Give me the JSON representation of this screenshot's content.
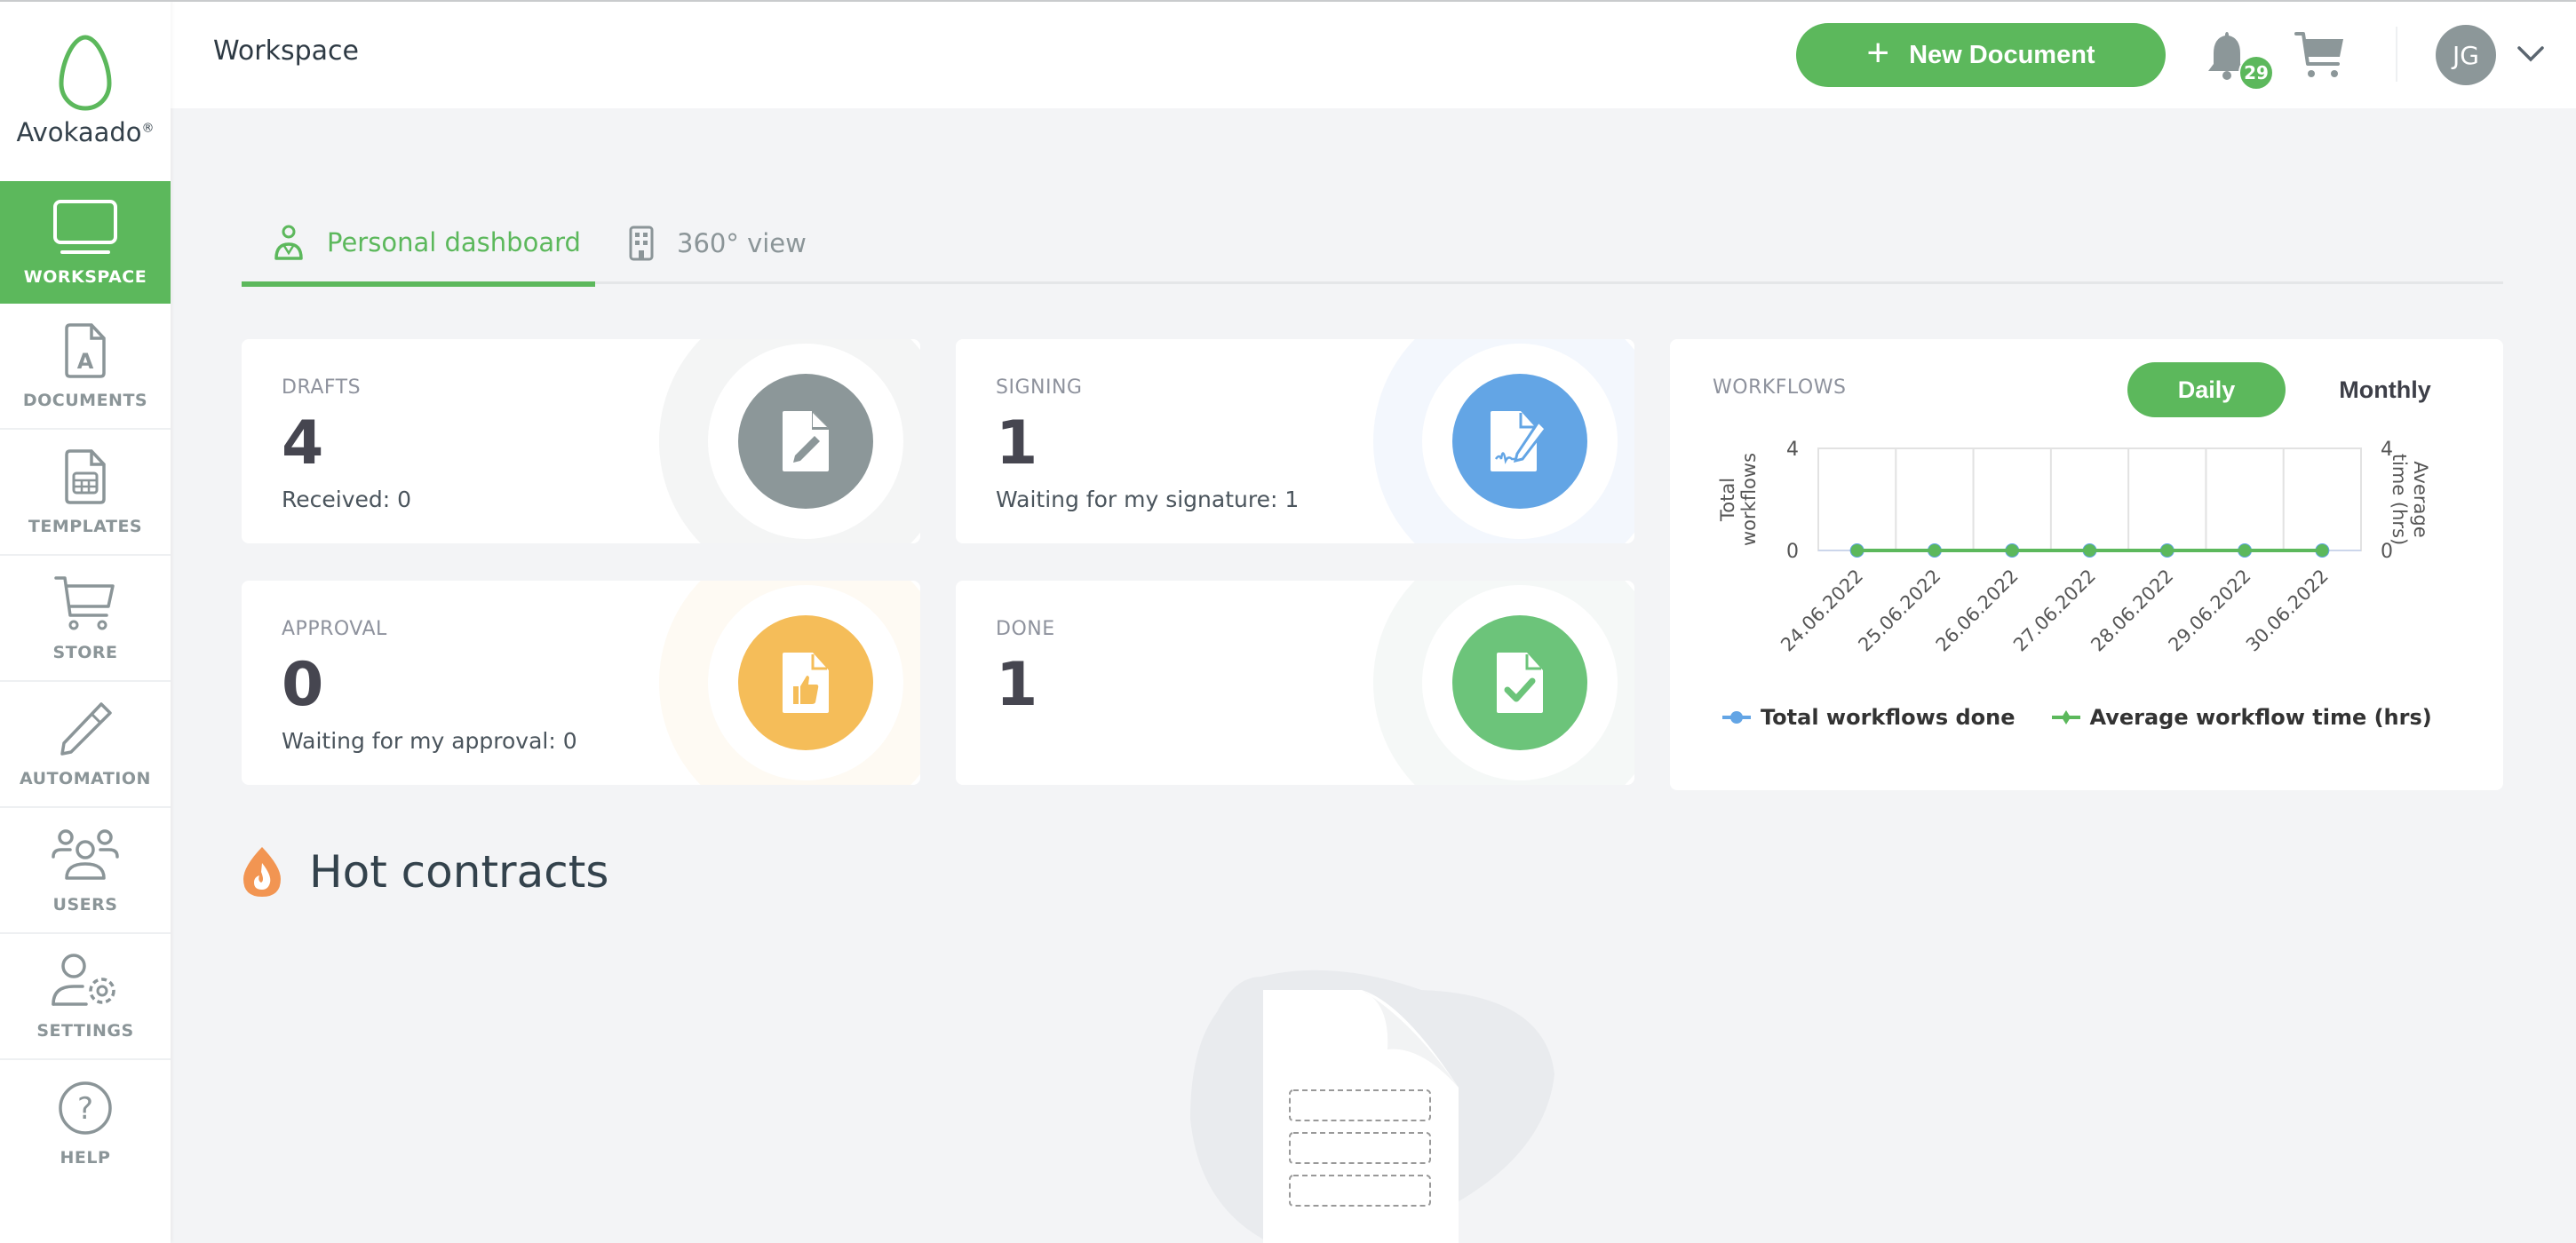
{
  "app": {
    "brand": "Avokaado",
    "brand_mark": "®"
  },
  "sidebar": {
    "items": [
      {
        "label": "WORKSPACE",
        "icon": "monitor-icon",
        "active": true
      },
      {
        "label": "DOCUMENTS",
        "icon": "document-a-icon"
      },
      {
        "label": "TEMPLATES",
        "icon": "template-icon"
      },
      {
        "label": "STORE",
        "icon": "cart-icon"
      },
      {
        "label": "AUTOMATION",
        "icon": "pen-icon"
      },
      {
        "label": "USERS",
        "icon": "users-icon"
      },
      {
        "label": "SETTINGS",
        "icon": "user-gear-icon"
      },
      {
        "label": "HELP",
        "icon": "help-icon"
      }
    ]
  },
  "header": {
    "title": "Workspace",
    "new_document_label": "New Document",
    "notifications_count": "29",
    "user_initials": "JG"
  },
  "tabs": [
    {
      "label": "Personal dashboard",
      "active": true,
      "icon": "person-icon"
    },
    {
      "label": "360° view",
      "active": false,
      "icon": "building-icon"
    }
  ],
  "stats": [
    {
      "title": "DRAFTS",
      "value": "4",
      "sub": "Received: 0",
      "color": "#8c9799",
      "icon": "draft-document-icon"
    },
    {
      "title": "SIGNING",
      "value": "1",
      "sub": "Waiting for my signature: 1",
      "color": "#63a5e5",
      "icon": "signature-document-icon"
    },
    {
      "title": "APPROVAL",
      "value": "0",
      "sub": "Waiting for my approval: 0",
      "color": "#f5bd59",
      "icon": "thumbs-up-document-icon"
    },
    {
      "title": "DONE",
      "value": "1",
      "sub": "",
      "color": "#6cc47a",
      "icon": "check-document-icon"
    }
  ],
  "workflows": {
    "title": "WORKFLOWS",
    "daily_label": "Daily",
    "monthly_label": "Monthly",
    "selected": "Daily"
  },
  "chart_data": {
    "type": "line",
    "title": "WORKFLOWS",
    "categories": [
      "24.06.2022",
      "25.06.2022",
      "26.06.2022",
      "27.06.2022",
      "28.06.2022",
      "29.06.2022",
      "30.06.2022"
    ],
    "series": [
      {
        "name": "Total workflows done",
        "values": [
          0,
          0,
          0,
          0,
          0,
          0,
          0
        ],
        "color": "#63a5e5",
        "axis": "left"
      },
      {
        "name": "Average workflow time (hrs)",
        "values": [
          0,
          0,
          0,
          0,
          0,
          0,
          0
        ],
        "color": "#5cb85c",
        "axis": "right"
      }
    ],
    "ylabel": "Total workflows",
    "y2label": "Average time (hrs)",
    "ylim": [
      0,
      4
    ],
    "y2lim": [
      0,
      4
    ],
    "yticks": [
      "0",
      "4"
    ],
    "y2ticks": [
      "0",
      "4"
    ],
    "grid": true,
    "legend": "bottom"
  },
  "hot_contracts": {
    "title": "Hot contracts"
  }
}
